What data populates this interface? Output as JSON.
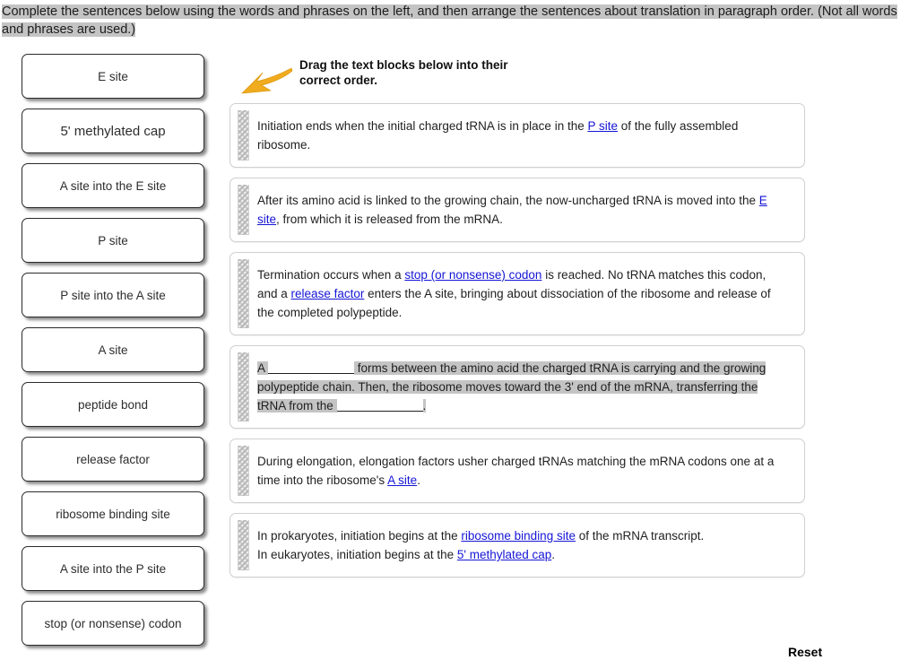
{
  "instruction": {
    "text": "Complete the sentences below using the words and phrases on the left, and then arrange the sentences about translation in paragraph order. (Not all words and phrases are used.)"
  },
  "drag_hint": {
    "line1": "Drag the text blocks below into their",
    "line2": "correct order.",
    "arrow_icon": "arrow-down-left-icon",
    "arrow_color": "#f0ab1e"
  },
  "word_bank": {
    "items": [
      {
        "label": "E site"
      },
      {
        "label": "5' methylated cap"
      },
      {
        "label": "A site into the E site"
      },
      {
        "label": "P site"
      },
      {
        "label": "P site into the A site"
      },
      {
        "label": "A site"
      },
      {
        "label": "peptide bond"
      },
      {
        "label": "release factor"
      },
      {
        "label": "ribosome binding site"
      },
      {
        "label": "A site into the P site"
      },
      {
        "label": "stop (or nonsense) codon"
      }
    ]
  },
  "blocks": [
    {
      "id": "block-initiation-ends",
      "selected": false,
      "parts": [
        {
          "t": "text",
          "v": "Initiation ends when the initial charged tRNA is in place in the "
        },
        {
          "t": "link",
          "v": "P site"
        },
        {
          "t": "text",
          "v": " of the fully assembled ribosome."
        }
      ]
    },
    {
      "id": "block-uncharged-trna-moved",
      "selected": false,
      "parts": [
        {
          "t": "text",
          "v": "After its amino acid is linked to the growing chain, the now-uncharged tRNA is moved into the "
        },
        {
          "t": "link",
          "v": "E site"
        },
        {
          "t": "text",
          "v": ", from which it is released from the mRNA."
        }
      ]
    },
    {
      "id": "block-termination",
      "selected": false,
      "parts": [
        {
          "t": "text",
          "v": "Termination occurs when a "
        },
        {
          "t": "link",
          "v": "stop (or nonsense) codon"
        },
        {
          "t": "text",
          "v": " is reached. No tRNA matches this codon, and a "
        },
        {
          "t": "link",
          "v": "release factor"
        },
        {
          "t": "text",
          "v": " enters the A site, bringing about dissociation of the ribosome and release of the completed polypeptide."
        }
      ]
    },
    {
      "id": "block-peptide-bond-forms",
      "selected": true,
      "parts": [
        {
          "t": "text",
          "v": "A "
        },
        {
          "t": "blank",
          "v": ""
        },
        {
          "t": "text",
          "v": " forms between the amino acid the charged tRNA is carrying and the growing polypeptide chain. Then, the ribosome moves toward the 3' end of the mRNA, transferring the tRNA from the "
        },
        {
          "t": "blank",
          "v": ""
        },
        {
          "t": "text",
          "v": "."
        }
      ]
    },
    {
      "id": "block-elongation",
      "selected": false,
      "parts": [
        {
          "t": "text",
          "v": "During elongation, elongation factors usher charged tRNAs matching the mRNA codons one at a time into the ribosome's "
        },
        {
          "t": "link",
          "v": "A site"
        },
        {
          "t": "text",
          "v": "."
        }
      ]
    },
    {
      "id": "block-initiation-begins",
      "selected": false,
      "parts": [
        {
          "t": "text",
          "v": "In prokaryotes, initiation begins at the "
        },
        {
          "t": "link",
          "v": "ribosome binding site"
        },
        {
          "t": "text",
          "v": " of the mRNA transcript."
        },
        {
          "t": "break",
          "v": ""
        },
        {
          "t": "text",
          "v": "In eukaryotes, initiation begins at the "
        },
        {
          "t": "link",
          "v": "5' methylated cap"
        },
        {
          "t": "text",
          "v": "."
        }
      ]
    }
  ],
  "reset": {
    "label": "Reset"
  }
}
